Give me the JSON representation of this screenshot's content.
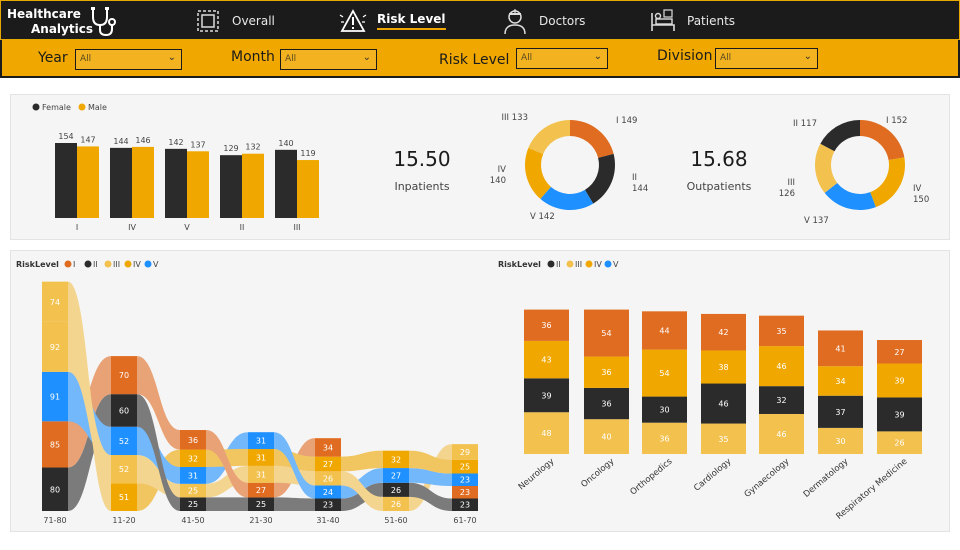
{
  "brand": {
    "line1": "Healthcare",
    "line2": "Analytics"
  },
  "nav": [
    {
      "label": "Overall",
      "icon": "dashboard-icon",
      "active": false
    },
    {
      "label": "Risk Level",
      "icon": "warning-icon",
      "active": true
    },
    {
      "label": "Doctors",
      "icon": "doctor-icon",
      "active": false
    },
    {
      "label": "Patients",
      "icon": "hospital-bed-icon",
      "active": false
    }
  ],
  "filters": [
    {
      "label": "Year",
      "value": "All"
    },
    {
      "label": "Month",
      "value": "All"
    },
    {
      "label": "Risk Level",
      "value": "All"
    },
    {
      "label": "Division",
      "value": "All"
    }
  ],
  "colors": {
    "female": "#2b2b2b",
    "male": "#f0a800",
    "I": "#e06c21",
    "II": "#2b2b2b",
    "III": "#f2c14e",
    "IV": "#f0a800",
    "V": "#1e90ff",
    "accent": "#f0a800",
    "dark": "#1b1b1b"
  },
  "kpis": [
    {
      "value": "15.50",
      "label": "Inpatients"
    },
    {
      "value": "15.68",
      "label": "Outpatients"
    }
  ],
  "chart_data": [
    {
      "type": "bar",
      "categories": [
        "I",
        "IV",
        "V",
        "II",
        "III"
      ],
      "series": [
        {
          "name": "Female",
          "values": [
            154,
            144,
            142,
            129,
            140
          ]
        },
        {
          "name": "Male",
          "values": [
            147,
            146,
            137,
            132,
            119
          ]
        }
      ],
      "legend_position": "top-left"
    },
    {
      "type": "pie",
      "donut": true,
      "labels": [
        "I",
        "II",
        "V",
        "IV",
        "III"
      ],
      "values": [
        149,
        144,
        142,
        140,
        133
      ]
    },
    {
      "type": "pie",
      "donut": true,
      "labels": [
        "I",
        "IV",
        "V",
        "III",
        "II"
      ],
      "values": [
        152,
        150,
        137,
        126,
        117
      ]
    },
    {
      "type": "bar",
      "stacked": true,
      "subtype": "ribbon",
      "legend_title": "RiskLevel",
      "legend": [
        "I",
        "II",
        "III",
        "IV",
        "V"
      ],
      "categories": [
        "71-80",
        "11-20",
        "41-50",
        "21-30",
        "31-40",
        "51-60",
        "61-70"
      ],
      "stacks": [
        [
          {
            "level": "II",
            "value": 80,
            "c": "II"
          },
          {
            "level": "I",
            "value": 85,
            "c": "I"
          },
          {
            "level": "V",
            "value": 91,
            "c": "V"
          },
          {
            "level": "III",
            "value": 92,
            "c": "III"
          },
          {
            "level": "IV",
            "value": 74,
            "c": "III"
          }
        ],
        [
          {
            "level": "IV",
            "value": 51,
            "c": "IV"
          },
          {
            "level": "III",
            "value": 52,
            "c": "III"
          },
          {
            "level": "V",
            "value": 52,
            "c": "V"
          },
          {
            "level": "II",
            "value": 60,
            "c": "II"
          },
          {
            "level": "I",
            "value": 70,
            "c": "I"
          }
        ],
        [
          {
            "level": "II",
            "value": 25,
            "c": "II"
          },
          {
            "level": "III",
            "value": 25,
            "c": "III"
          },
          {
            "level": "V",
            "value": 31,
            "c": "V"
          },
          {
            "level": "IV",
            "value": 32,
            "c": "IV"
          },
          {
            "level": "I",
            "value": 36,
            "c": "I"
          }
        ],
        [
          {
            "level": "II",
            "value": 25,
            "c": "II"
          },
          {
            "level": "I",
            "value": 27,
            "c": "I"
          },
          {
            "level": "III",
            "value": 31,
            "c": "III"
          },
          {
            "level": "IV",
            "value": 31,
            "c": "IV"
          },
          {
            "level": "V",
            "value": 31,
            "c": "V"
          }
        ],
        [
          {
            "level": "II",
            "value": 23,
            "c": "II"
          },
          {
            "level": "V",
            "value": 24,
            "c": "V"
          },
          {
            "level": "III",
            "value": 26,
            "c": "III"
          },
          {
            "level": "IV",
            "value": 27,
            "c": "IV"
          },
          {
            "level": "I",
            "value": 34,
            "c": "I"
          }
        ],
        [
          {
            "level": "III",
            "value": 26,
            "c": "III"
          },
          {
            "level": "II",
            "value": 26,
            "c": "II"
          },
          {
            "level": "V",
            "value": 27,
            "c": "V"
          },
          {
            "level": "IV",
            "value": 32,
            "c": "IV"
          }
        ],
        [
          {
            "level": "II",
            "value": 23,
            "c": "II"
          },
          {
            "level": "I",
            "value": 23,
            "c": "I"
          },
          {
            "level": "V",
            "value": 23,
            "c": "V"
          },
          {
            "level": "IV",
            "value": 25,
            "c": "IV"
          },
          {
            "level": "III",
            "value": 29,
            "c": "III"
          }
        ]
      ]
    },
    {
      "type": "bar",
      "stacked": true,
      "legend_title": "RiskLevel",
      "legend": [
        "II",
        "III",
        "IV",
        "V"
      ],
      "categories": [
        "Neurology",
        "Oncology",
        "Orthopedics",
        "Cardiology",
        "Gynaecology",
        "Dermatology",
        "Respiratory Medicine"
      ],
      "series": [
        {
          "name": "II",
          "values": [
            48,
            40,
            36,
            35,
            46,
            30,
            26
          ]
        },
        {
          "name": "III",
          "values": [
            39,
            36,
            30,
            46,
            32,
            37,
            39
          ]
        },
        {
          "name": "IV",
          "values": [
            43,
            36,
            54,
            38,
            46,
            34,
            39
          ]
        },
        {
          "name": "V",
          "values": [
            36,
            54,
            44,
            42,
            35,
            41,
            27
          ]
        }
      ]
    }
  ]
}
